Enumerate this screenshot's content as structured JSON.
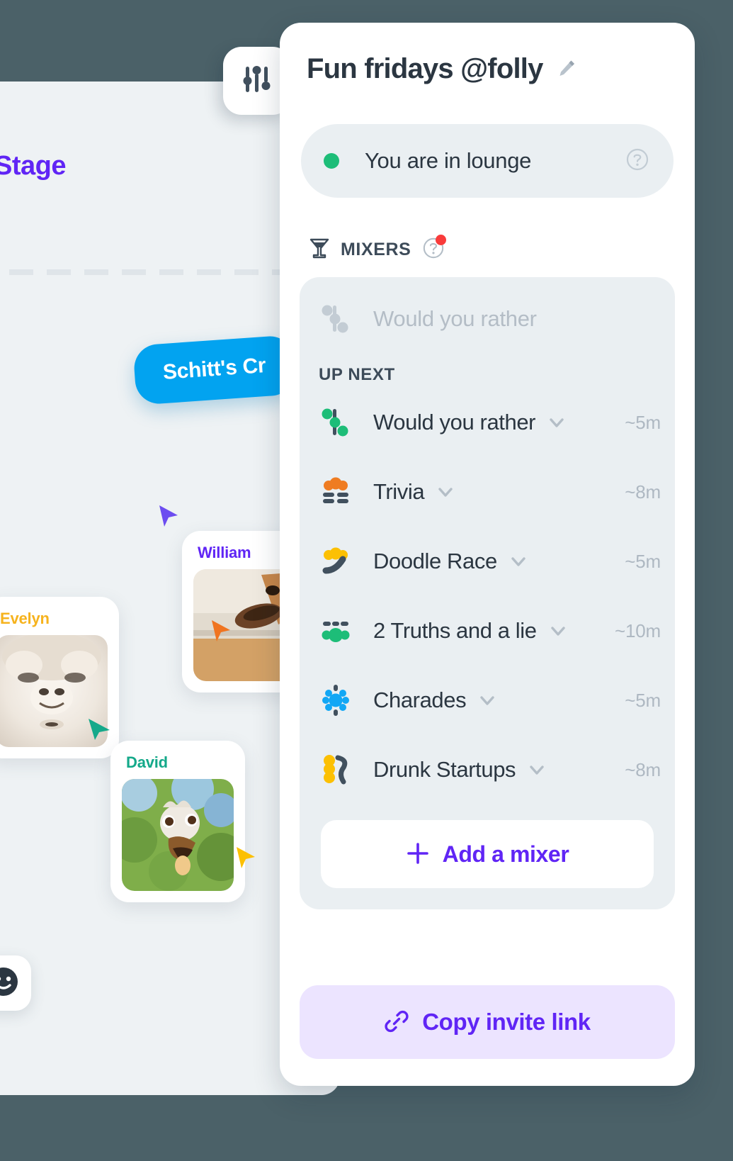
{
  "background": {
    "stage_title": "Stage",
    "topic_pill": "Schitt's Cr",
    "participants": [
      {
        "name": "Evelyn",
        "color": "#f6b31e",
        "avatar": "alpaca-photo"
      },
      {
        "name": "William",
        "color": "#6025f5",
        "avatar": "giraffe-photo"
      },
      {
        "name": "David",
        "color": "#15a98a",
        "avatar": "ostrich-photo"
      }
    ],
    "cursors": [
      "purple-cursor",
      "orange-cursor",
      "teal-cursor",
      "yellow-cursor"
    ],
    "emoji_button_icon": "smiley-face-icon"
  },
  "settings_chip": {
    "icon": "sliders-icon"
  },
  "panel": {
    "title": "Fun fridays @folly",
    "edit_icon": "pencil-icon",
    "status": {
      "label": "You are in lounge",
      "dot_color": "#1dbd78",
      "help_icon": "question-circle-icon"
    },
    "mixers_heading": {
      "icon": "cocktail-glass-icon",
      "label": "MIXERS",
      "help_icon": "question-circle-icon",
      "badge_color": "#f93b3b"
    },
    "current_mixer": {
      "icon": "would-you-rather-icon",
      "label": "Would you rather"
    },
    "up_next_label": "UP NEXT",
    "mixers": [
      {
        "name": "Would you rather",
        "duration": "~5m",
        "icon": "would-you-rather-icon",
        "color": "#1dbd78"
      },
      {
        "name": "Trivia",
        "duration": "~8m",
        "icon": "trivia-icon",
        "color": "#ef7c22"
      },
      {
        "name": "Doodle Race",
        "duration": "~5m",
        "icon": "doodle-race-icon",
        "color": "#fcc003"
      },
      {
        "name": "2 Truths and a lie",
        "duration": "~10m",
        "icon": "two-truths-icon",
        "color": "#1dbd78"
      },
      {
        "name": "Charades",
        "duration": "~5m",
        "icon": "charades-icon",
        "color": "#12a7f5"
      },
      {
        "name": "Drunk Startups",
        "duration": "~8m",
        "icon": "drunk-startups-icon",
        "color": "#fcc003"
      }
    ],
    "add_mixer": {
      "label": "Add a mixer",
      "icon": "plus-icon",
      "color": "#6025f5"
    },
    "copy_invite": {
      "label": "Copy invite link",
      "icon": "link-icon",
      "color": "#6025f5"
    }
  }
}
